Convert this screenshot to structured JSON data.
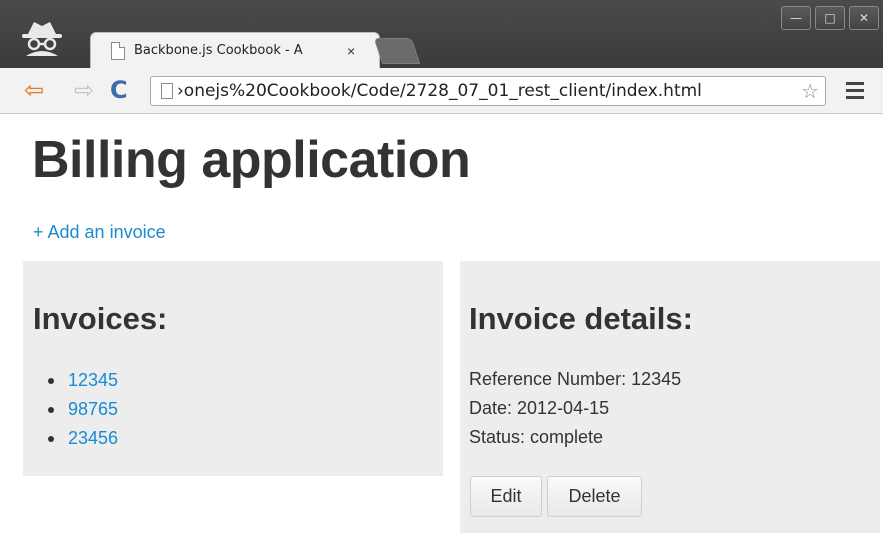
{
  "browser": {
    "tab_title": "Backbone.js Cookbook - A",
    "tab_close": "×",
    "url": "›onejs%20Cookbook/Code/2728_07_01_rest_client/index.html",
    "window_buttons": [
      "—",
      "□",
      "✕"
    ],
    "back": "⇦",
    "forward": "⇨",
    "reload": "C",
    "star": "☆"
  },
  "page": {
    "title": "Billing application",
    "add_link": "+ Add an invoice",
    "invoices_heading": "Invoices:",
    "invoices": [
      "12345",
      "98765",
      "23456"
    ],
    "details_heading": "Invoice details:",
    "details": {
      "reference": "Reference Number: 12345",
      "date": "Date: 2012-04-15",
      "status": "Status: complete"
    },
    "edit_label": "Edit",
    "delete_label": "Delete"
  },
  "colors": {
    "link": "#1a8bd0",
    "panel_bg": "#ededed",
    "text": "#333333"
  }
}
